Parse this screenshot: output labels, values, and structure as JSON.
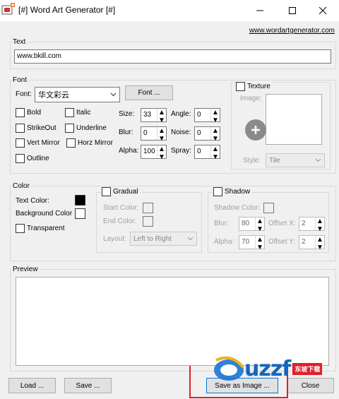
{
  "window": {
    "title": "[#] Word Art Generator [#]"
  },
  "link": "www.wordartgenerator.com",
  "text_group": {
    "legend": "Text",
    "value": "www.bkill.com"
  },
  "font_group": {
    "legend": "Font",
    "font_label": "Font:",
    "font_value": "华文彩云",
    "font_button": "Font ...",
    "styles": {
      "bold": "Bold",
      "italic": "Italic",
      "strikeout": "StrikeOut",
      "underline": "Underline",
      "vert_mirror": "Vert Mirror",
      "horz_mirror": "Horz Mirror",
      "outline": "Outline"
    },
    "size": {
      "label": "Size:",
      "value": "33"
    },
    "blur": {
      "label": "Blur:",
      "value": "0"
    },
    "alpha": {
      "label": "Alpha:",
      "value": "100"
    },
    "angle": {
      "label": "Angle:",
      "value": "0"
    },
    "noise": {
      "label": "Noise:",
      "value": "0"
    },
    "spray": {
      "label": "Spray:",
      "value": "0"
    }
  },
  "texture": {
    "label": "Texture",
    "image_label": "Image:",
    "style_label": "Style:",
    "style_value": "Tile"
  },
  "color_group": {
    "legend": "Color",
    "text_color_label": "Text Color:",
    "text_color": "#000000",
    "bg_color_label": "Background Color",
    "bg_color": "#ffffff",
    "transparent_label": "Transparent"
  },
  "gradual": {
    "label": "Gradual",
    "start_label": "Start Color:",
    "end_label": "End Color:",
    "layout_label": "Layout:",
    "layout_value": "Left to Right"
  },
  "shadow": {
    "label": "Shadow",
    "color_label": "Shadow Color:",
    "blur_label": "Blur:",
    "blur_value": "80",
    "alpha_label": "Alpha:",
    "alpha_value": "70",
    "offx_label": "Offset X:",
    "offx_value": "2",
    "offy_label": "Offset Y:",
    "offy_value": "2"
  },
  "preview": {
    "legend": "Preview"
  },
  "buttons": {
    "load": "Load ...",
    "save": "Save ...",
    "save_image": "Save as Image ...",
    "close": "Close"
  },
  "watermark": {
    "brand": "uzzf",
    "tag": "东坡下载"
  },
  "icons": {
    "app": "app-icon",
    "minimize": "minimize-icon",
    "maximize": "maximize-icon",
    "close": "close-icon",
    "add": "plus-icon",
    "dropdown": "chevron-down-icon",
    "spin": "spin-arrows-icon"
  }
}
